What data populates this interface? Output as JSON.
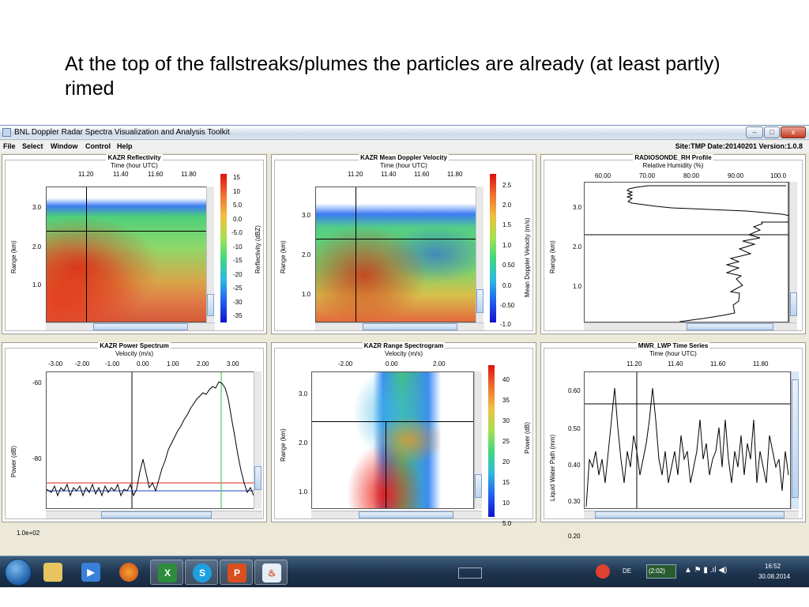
{
  "slide": {
    "title": "At the top of the fallstreaks/plumes the particles are already (at least partly) rimed"
  },
  "window": {
    "title": "BNL Doppler Radar Spectra Visualization and Analysis Toolkit",
    "controls": {
      "minimize": "–",
      "maximize": "□",
      "close": "x"
    }
  },
  "menubar": {
    "items": [
      "File",
      "Select",
      "Window",
      "Control",
      "Help"
    ],
    "site_info": "Site:TMP  Date:20140201  Version:1.0.8"
  },
  "panels": [
    {
      "title": "KAZR Reflectivity",
      "xlabel": "Time (hour UTC)",
      "ylabel": "Range (km)",
      "xticks": [
        "11.20",
        "11.40",
        "11.60",
        "11.80"
      ],
      "yticks": [
        "3.0",
        "2.0",
        "1.0"
      ],
      "colorbar_label": "Reflectivity (dBZ)",
      "colorbar_ticks": [
        "15",
        "10",
        "5.0",
        "0.0",
        "-5.0",
        "-10",
        "-15",
        "-20",
        "-25",
        "-30",
        "-35"
      ]
    },
    {
      "title": "KAZR Mean Doppler Velocity",
      "xlabel": "Time (hour UTC)",
      "ylabel": "Range (km)",
      "xticks": [
        "11.20",
        "11.40",
        "11.60",
        "11.80"
      ],
      "yticks": [
        "3.0",
        "2.0",
        "1.0"
      ],
      "colorbar_label": "Mean Doppler Velocity (m/s)",
      "colorbar_ticks": [
        "2.5",
        "2.0",
        "1.5",
        "1.0",
        "0.50",
        "0.0",
        "-0.50",
        "-1.0"
      ]
    },
    {
      "title": "RADIOSONDE_RH Profile",
      "xlabel": "Relative Humidity (%)",
      "ylabel": "Range (km)",
      "xticks": [
        "60.00",
        "70.00",
        "80.00",
        "90.00",
        "100.0"
      ],
      "yticks": [
        "3.0",
        "2.0",
        "1.0"
      ]
    },
    {
      "title": "KAZR Power Spectrum",
      "xlabel": "Velocity (m/s)",
      "ylabel": "Power (dB)",
      "xticks": [
        "-3.00",
        "-2.00",
        "-1.00",
        "0.00",
        "1.00",
        "2.00",
        "3.00"
      ],
      "yticks": [
        "-60",
        "-80",
        "1.0e+02"
      ]
    },
    {
      "title": "KAZR Range Spectrogram",
      "xlabel": "Velocity (m/s)",
      "ylabel": "Range (km)",
      "xticks": [
        "-2.00",
        "0.00",
        "2.00"
      ],
      "yticks": [
        "3.0",
        "2.0",
        "1.0"
      ],
      "colorbar_label": "Power (dB)",
      "colorbar_ticks": [
        "40",
        "35",
        "30",
        "25",
        "20",
        "15",
        "10",
        "5.0"
      ]
    },
    {
      "title": "MWR_LWP Time Series",
      "xlabel": "Time (hour UTC)",
      "ylabel": "Liquid Water Path (mm)",
      "xticks": [
        "11.20",
        "11.40",
        "11.60",
        "11.80"
      ],
      "yticks": [
        "0.60",
        "0.50",
        "0.40",
        "0.30",
        "0.20"
      ]
    }
  ],
  "colors": {
    "taskbar": "#1e3550",
    "spectrum_red_line": "#e02020",
    "spectrum_blue_line": "#2040d0",
    "spectrum_green_line": "#30c030"
  },
  "taskbar": {
    "apps": [
      "start-orb",
      "explorer-icon",
      "media-player-icon",
      "firefox-icon",
      "excel-icon",
      "skype-icon",
      "powerpoint-icon",
      "java-icon"
    ],
    "tray": {
      "language": "DE",
      "battery": "(2:02)",
      "time": "16:52",
      "date": "30.08.2014"
    }
  }
}
